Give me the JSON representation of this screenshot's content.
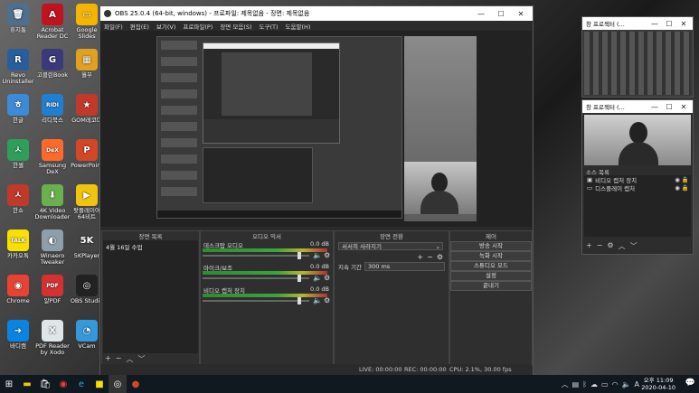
{
  "desktop": {
    "icons": [
      {
        "label": "휴지통",
        "color": "#4f6f8f",
        "glyph": "🗑"
      },
      {
        "label": "Acrobat Reader DC",
        "color": "#c1121f",
        "glyph": "A"
      },
      {
        "label": "Google Slides",
        "color": "#f4b400",
        "glyph": "▭"
      },
      {
        "label": "Revo Uninstaller",
        "color": "#2a5d9c",
        "glyph": "R"
      },
      {
        "label": "고클린Book",
        "color": "#3a3a7a",
        "glyph": "G"
      },
      {
        "label": "월부",
        "color": "#e0a020",
        "glyph": "▦"
      },
      {
        "label": "한글",
        "color": "#3d8bd6",
        "glyph": "ㅎ"
      },
      {
        "label": "리디북스",
        "color": "#1f7fd1",
        "glyph": "RIDI"
      },
      {
        "label": "GOM레코더",
        "color": "#c0392b",
        "glyph": "★"
      },
      {
        "label": "한셀",
        "color": "#2e9e5b",
        "glyph": "ㅅ"
      },
      {
        "label": "Samsung DeX",
        "color": "#ff6a2b",
        "glyph": "DeX"
      },
      {
        "label": "PowerPoint",
        "color": "#d24726",
        "glyph": "P"
      },
      {
        "label": "한쇼",
        "color": "#c0392b",
        "glyph": "ㅅ"
      },
      {
        "label": "4K Video Downloader",
        "color": "#6ab04c",
        "glyph": "⬇"
      },
      {
        "label": "팟플레이어 64비트",
        "color": "#f1c40f",
        "glyph": "▶"
      },
      {
        "label": "카카오톡",
        "color": "#f9e000",
        "glyph": "TALK"
      },
      {
        "label": "Winaero Tweaker",
        "color": "#8e9eab",
        "glyph": "◐"
      },
      {
        "label": "5KPlayer",
        "color": "#444",
        "glyph": "5K"
      },
      {
        "label": "Chrome",
        "color": "#e94235",
        "glyph": "◉"
      },
      {
        "label": "알PDF",
        "color": "#d63031",
        "glyph": "PDF"
      },
      {
        "label": "OBS Studio",
        "color": "#222",
        "glyph": "◎"
      },
      {
        "label": "바디캠",
        "color": "#0984e3",
        "glyph": "➜"
      },
      {
        "label": "PDF Reader by Xodo",
        "color": "#dfe6e9",
        "glyph": "X"
      },
      {
        "label": "VCam",
        "color": "#3498db",
        "glyph": "◔"
      }
    ]
  },
  "obs": {
    "title": "OBS 25.0.4 (64-bit, windows) - 프로파일: 제목없음 - 장면: 제목없음",
    "menu": [
      "파일(F)",
      "편집(E)",
      "보기(V)",
      "프로파일(P)",
      "장면 모음(S)",
      "도구(T)",
      "도움말(H)"
    ],
    "docks": {
      "scenes_title": "장면 목록",
      "scene_item": "4월 16일 수업",
      "mixer_title": "오디오 믹서",
      "transition_title": "장면 전환",
      "controls_title": "제어"
    },
    "mixer": [
      {
        "name": "데스크탑 오디오",
        "db": "0.0 dB",
        "level": 0.92
      },
      {
        "name": "마이크/보조",
        "db": "0.0 dB",
        "level": 0.92
      },
      {
        "name": "비디오 캡처 장치",
        "db": "0.0 dB",
        "level": 0.92
      }
    ],
    "transition": {
      "type": "서서히 사라지기",
      "duration_label": "지속 기간",
      "duration_value": "300 ms"
    },
    "controls": [
      "방송 시작",
      "녹화 시작",
      "스튜디오 모드",
      "설정",
      "끝내기"
    ],
    "status": {
      "live": "LIVE: 00:00:00",
      "rec": "REC: 00:00:00",
      "cpu": "CPU: 2.1%, 30.00 fps"
    }
  },
  "projector_top": {
    "title": "창 프로젝터 (..."
  },
  "projector_bottom": {
    "title": "창 프로젝터 (...",
    "sources_title": "소스 목록",
    "sources": [
      "비디오 캡처 장치",
      "디스플레이 캡처"
    ]
  },
  "taskbar": {
    "time": "오후 11:09",
    "date": "2020-04-10"
  }
}
